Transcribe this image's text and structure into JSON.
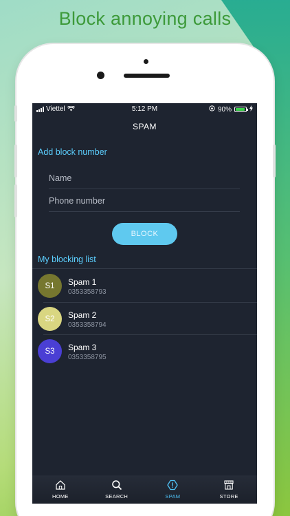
{
  "promo": {
    "headline": "Block annoying calls"
  },
  "status_bar": {
    "carrier": "Viettel",
    "time": "5:12 PM",
    "battery": "90%",
    "battery_level": 0.9
  },
  "nav": {
    "title": "SPAM"
  },
  "add_block": {
    "title": "Add block number",
    "name_placeholder": "Name",
    "phone_placeholder": "Phone number",
    "block_label": "BLOCK"
  },
  "blocking_list": {
    "title": "My blocking list",
    "items": [
      {
        "initials": "S1",
        "name": "Spam 1",
        "number": "0353358793",
        "color": "#76772f"
      },
      {
        "initials": "S2",
        "name": "Spam 2",
        "number": "0353358794",
        "color": "#d9d681"
      },
      {
        "initials": "S3",
        "name": "Spam 3",
        "number": "0353358795",
        "color": "#4a3fd4"
      }
    ]
  },
  "tabs": [
    {
      "label": "HOME",
      "icon": "home-icon",
      "active": false
    },
    {
      "label": "SEARCH",
      "icon": "search-icon",
      "active": false
    },
    {
      "label": "SPAM",
      "icon": "spam-shield-icon",
      "active": true
    },
    {
      "label": "STORE",
      "icon": "store-icon",
      "active": false
    }
  ],
  "colors": {
    "accent": "#5ccfff",
    "screen_bg": "#1e2430",
    "headline": "#3d9a3a"
  }
}
